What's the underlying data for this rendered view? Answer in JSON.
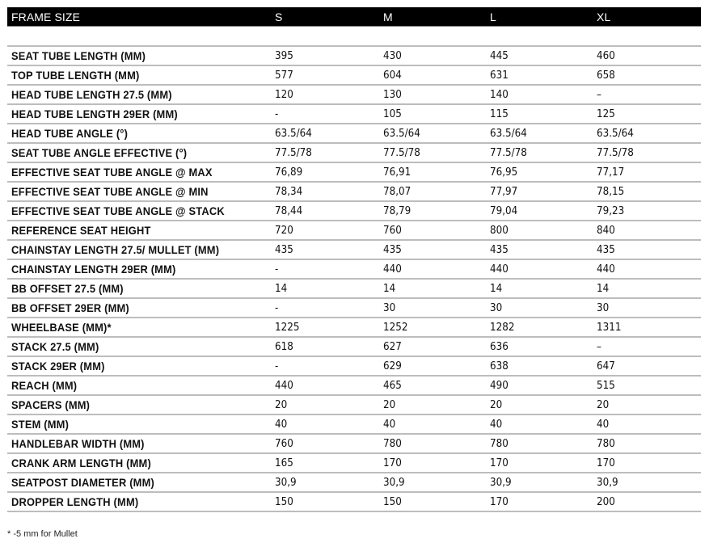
{
  "header": {
    "label": "FRAME SIZE",
    "sizes": [
      "S",
      "M",
      "L",
      "XL"
    ]
  },
  "rows": [
    {
      "label": "SEAT TUBE LENGTH (MM)",
      "values": [
        "395",
        "430",
        "445",
        "460"
      ]
    },
    {
      "label": "TOP TUBE LENGTH (MM)",
      "values": [
        "577",
        "604",
        "631",
        "658"
      ]
    },
    {
      "label": "HEAD TUBE LENGTH 27.5 (MM)",
      "values": [
        "120",
        "130",
        "140",
        "–"
      ]
    },
    {
      "label": "HEAD TUBE LENGTH 29ER (MM)",
      "values": [
        "-",
        "105",
        "115",
        "125"
      ]
    },
    {
      "label": "HEAD TUBE ANGLE (°)",
      "values": [
        "63.5/64",
        "63.5/64",
        "63.5/64",
        "63.5/64"
      ]
    },
    {
      "label": "SEAT TUBE ANGLE EFFECTIVE (°)",
      "values": [
        "77.5/78",
        "77.5/78",
        "77.5/78",
        "77.5/78"
      ]
    },
    {
      "label": "EFFECTIVE SEAT TUBE ANGLE @ MAX",
      "values": [
        "76,89",
        "76,91",
        "76,95",
        "77,17"
      ]
    },
    {
      "label": "EFFECTIVE SEAT TUBE ANGLE @ MIN",
      "values": [
        "78,34",
        "78,07",
        "77,97",
        "78,15"
      ]
    },
    {
      "label": "EFFECTIVE SEAT TUBE ANGLE @ STACK",
      "values": [
        "78,44",
        "78,79",
        "79,04",
        "79,23"
      ]
    },
    {
      "label": "REFERENCE SEAT HEIGHT",
      "values": [
        "720",
        "760",
        "800",
        "840"
      ]
    },
    {
      "label": "CHAINSTAY LENGTH 27.5/ MULLET (MM)",
      "values": [
        "435",
        "435",
        "435",
        "435"
      ]
    },
    {
      "label": "CHAINSTAY LENGTH 29ER (MM)",
      "values": [
        "-",
        "440",
        "440",
        "440"
      ]
    },
    {
      "label": "BB OFFSET 27.5 (MM)",
      "values": [
        "14",
        "14",
        "14",
        "14"
      ]
    },
    {
      "label": "BB OFFSET 29ER (MM)",
      "values": [
        "-",
        "30",
        "30",
        "30"
      ]
    },
    {
      "label": "WHEELBASE (MM)*",
      "values": [
        "1225",
        "1252",
        "1282",
        "1311"
      ]
    },
    {
      "label": "STACK 27.5 (MM)",
      "values": [
        "618",
        "627",
        "636",
        "–"
      ]
    },
    {
      "label": "STACK 29ER (MM)",
      "values": [
        "-",
        "629",
        "638",
        "647"
      ]
    },
    {
      "label": "REACH (MM)",
      "values": [
        "440",
        "465",
        "490",
        "515"
      ]
    },
    {
      "label": "SPACERS (MM)",
      "values": [
        "20",
        "20",
        "20",
        "20"
      ]
    },
    {
      "label": "STEM (MM)",
      "values": [
        "40",
        "40",
        "40",
        "40"
      ]
    },
    {
      "label": "HANDLEBAR WIDTH (MM)",
      "values": [
        "760",
        "780",
        "780",
        "780"
      ]
    },
    {
      "label": "CRANK ARM LENGTH (MM)",
      "values": [
        "165",
        "170",
        "170",
        "170"
      ]
    },
    {
      "label": "SEATPOST DIAMETER (MM)",
      "values": [
        "30,9",
        "30,9",
        "30,9",
        "30,9"
      ]
    },
    {
      "label": "DROPPER LENGTH (MM)",
      "values": [
        "150",
        "150",
        "170",
        "200"
      ]
    }
  ],
  "footnote": "*  -5 mm for Mullet"
}
